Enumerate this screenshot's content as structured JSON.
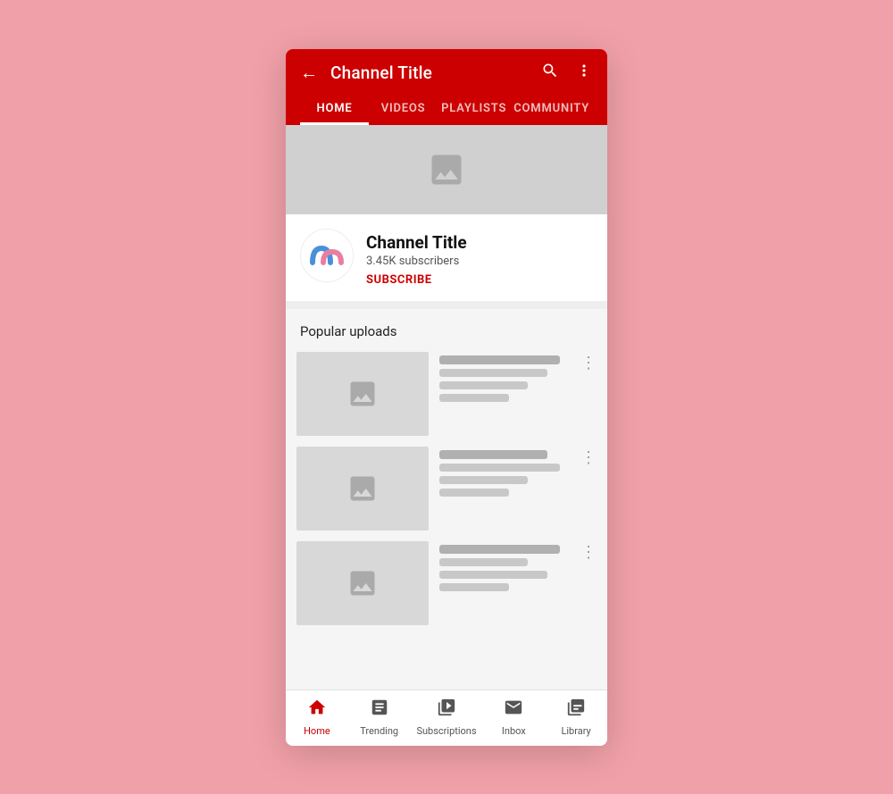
{
  "app": {
    "bg_color": "#f0a0a8",
    "accent_color": "#cc0000"
  },
  "header": {
    "back_label": "←",
    "channel_title": "Channel Title",
    "search_icon": "search-icon",
    "more_icon": "more-vert-icon"
  },
  "tabs": [
    {
      "id": "home",
      "label": "HOME",
      "active": true
    },
    {
      "id": "videos",
      "label": "VIDEOS",
      "active": false
    },
    {
      "id": "playlists",
      "label": "PLAYLISTS",
      "active": false
    },
    {
      "id": "community",
      "label": "COMMUNITY",
      "active": false
    }
  ],
  "channel": {
    "name": "Channel Title",
    "subscribers": "3.45K subscribers",
    "subscribe_label": "SUBSCRIBE"
  },
  "popular_uploads": {
    "section_title": "Popular uploads",
    "videos": [
      {
        "id": 1
      },
      {
        "id": 2
      },
      {
        "id": 3
      }
    ]
  },
  "bottom_nav": [
    {
      "id": "home",
      "label": "Home",
      "icon": "home-icon",
      "active": true
    },
    {
      "id": "trending",
      "label": "Trending",
      "icon": "trending-icon",
      "active": false
    },
    {
      "id": "subscriptions",
      "label": "Subscriptions",
      "icon": "subscriptions-icon",
      "active": false
    },
    {
      "id": "inbox",
      "label": "Inbox",
      "icon": "inbox-icon",
      "active": false
    },
    {
      "id": "library",
      "label": "Library",
      "icon": "library-icon",
      "active": false
    }
  ]
}
